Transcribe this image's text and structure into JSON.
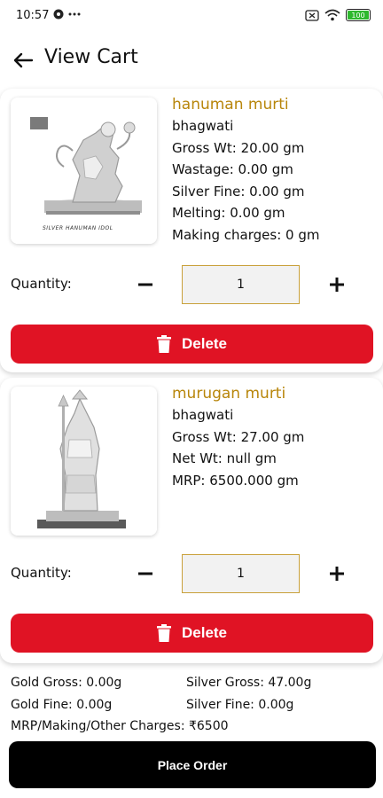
{
  "status_bar": {
    "time": "10:57",
    "battery_level": "100",
    "icons": [
      "app-icon",
      "more-icon",
      "sim-icon",
      "wifi-icon",
      "battery-icon"
    ]
  },
  "header": {
    "title": "View Cart",
    "back_icon": "arrow-left-icon"
  },
  "cart_items": [
    {
      "name": "hanuman murti",
      "brand": "bhagwati",
      "details": [
        "Gross Wt: 20.00 gm",
        "Wastage: 0.00 gm",
        "Silver Fine: 0.00 gm",
        "Melting: 0.00 gm",
        "Making charges: 0 gm"
      ],
      "image_caption": "SILVER HANUMAN IDOL",
      "quantity_label": "Quantity:",
      "quantity": "1",
      "delete_label": "Delete"
    },
    {
      "name": "murugan murti",
      "brand": "bhagwati",
      "details": [
        "Gross Wt: 27.00 gm",
        "Net Wt: null gm",
        "MRP: 6500.000 gm"
      ],
      "quantity_label": "Quantity:",
      "quantity": "1",
      "delete_label": "Delete"
    }
  ],
  "summary": {
    "gold_gross": "Gold Gross:  0.00g",
    "silver_gross": "Silver Gross:  47.00g",
    "gold_fine": "Gold Fine:  0.00g",
    "silver_fine": "Silver Fine:  0.00g",
    "charges": "MRP/Making/Other Charges:  ₹6500"
  },
  "place_order_label": "Place Order",
  "colors": {
    "accent_gold": "#b8860b",
    "delete_red": "#e01324",
    "order_black": "#000000"
  }
}
